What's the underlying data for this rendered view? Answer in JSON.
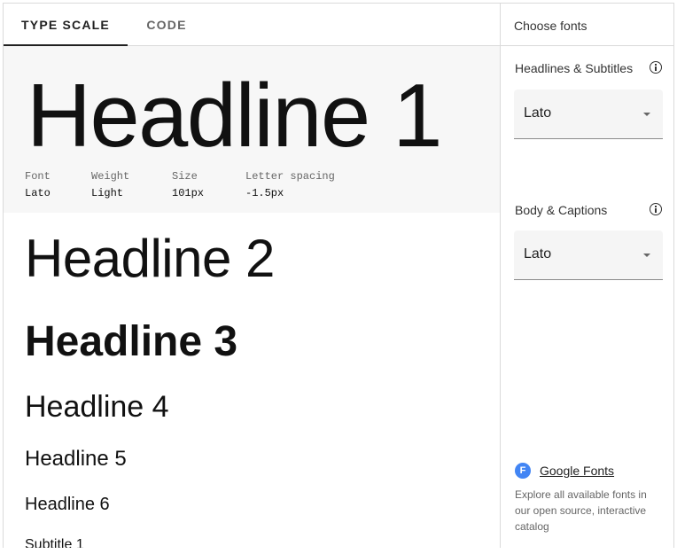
{
  "tabs": {
    "type_scale": "TYPE SCALE",
    "code": "CODE"
  },
  "headline1": {
    "text": "Headline 1",
    "meta": [
      {
        "label": "Font",
        "value": "Lato"
      },
      {
        "label": "Weight",
        "value": "Light"
      },
      {
        "label": "Size",
        "value": "101px"
      },
      {
        "label": "Letter spacing",
        "value": "-1.5px"
      }
    ]
  },
  "scale": {
    "h2": "Headline 2",
    "h3": "Headline 3",
    "h4": "Headline 4",
    "h5": "Headline 5",
    "h6": "Headline 6",
    "subtitle1": "Subtitle 1"
  },
  "sidebar": {
    "title": "Choose fonts",
    "headlines": {
      "label": "Headlines & Subtitles",
      "value": "Lato"
    },
    "body": {
      "label": "Body & Captions",
      "value": "Lato"
    },
    "google_fonts": {
      "icon_letter": "F",
      "link": "Google Fonts",
      "description": "Explore all available fonts in our open source, interactive catalog"
    }
  },
  "colors": {
    "google_blue": "#4285f4"
  }
}
